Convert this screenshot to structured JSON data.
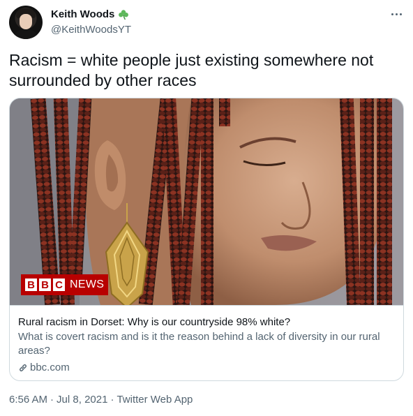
{
  "author": {
    "display_name": "Keith Woods",
    "handle": "@KeithWoodsYT",
    "badge_icon": "shamrock-icon",
    "badge_color": "#5db85b"
  },
  "tweet": {
    "text": "Racism = white people just existing somewhere not surrounded by other races"
  },
  "card": {
    "image_logo": "BBC NEWS",
    "logo_letters": [
      "B",
      "B",
      "C"
    ],
    "logo_word": "NEWS",
    "title": "Rural racism in Dorset: Why is our countryside 98% white?",
    "description": "What is covert racism and is it the reason behind a lack of diversity in our rural areas?",
    "domain": "bbc.com",
    "domain_icon": "link-icon"
  },
  "meta": {
    "time": "6:56 AM",
    "separator_1": "·",
    "date": "Jul 8, 2021",
    "separator_2": "·",
    "source": "Twitter Web App"
  },
  "colors": {
    "text_primary": "#0f1419",
    "text_secondary": "#536471",
    "border": "#cfd9de",
    "bbc_red": "#b80000"
  }
}
